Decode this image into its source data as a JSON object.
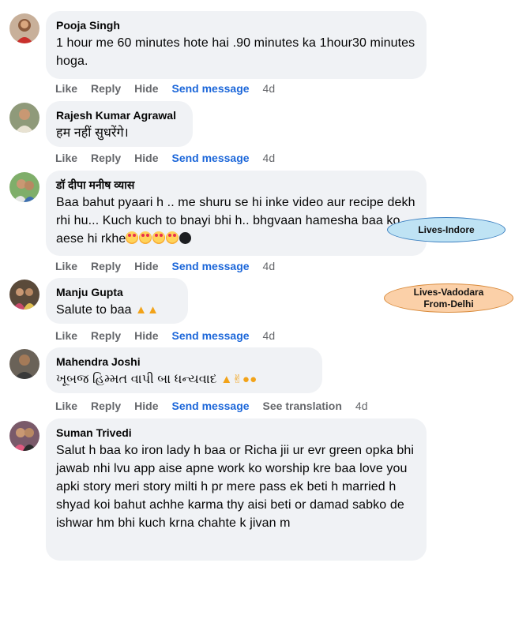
{
  "comments": [
    {
      "author": "Pooja Singh",
      "text": "1 hour me 60 minutes hote hai .90 minutes ka 1hour30 minutes hoga.",
      "actions": {
        "like": "Like",
        "reply": "Reply",
        "hide": "Hide",
        "send": "Send message",
        "time": "4d"
      }
    },
    {
      "author": "Rajesh Kumar Agrawal",
      "text": "हम नहीं सुधरेंगे।",
      "actions": {
        "like": "Like",
        "reply": "Reply",
        "hide": "Hide",
        "send": "Send message",
        "time": "4d"
      }
    },
    {
      "author": "डॉ दीपा मनीष व्यास",
      "text": "Baa bahut pyaari h .. me shuru se hi inke video aur recipe dekh rhi hu... Kuch kuch to bnayi bhi h.. bhgvaan hamesha baa ko aese hi rkhe",
      "actions": {
        "like": "Like",
        "reply": "Reply",
        "hide": "Hide",
        "send": "Send message",
        "time": "4d"
      }
    },
    {
      "author": "Manju Gupta",
      "text": "Salute to baa",
      "actions": {
        "like": "Like",
        "reply": "Reply",
        "hide": "Hide",
        "send": "Send message",
        "time": "4d"
      }
    },
    {
      "author": "Mahendra Joshi",
      "text": "ખૂબજ હિમ્મત વાપી બા ધન્યવાદ",
      "actions": {
        "like": "Like",
        "reply": "Reply",
        "hide": "Hide",
        "send": "Send message",
        "translate": "See translation",
        "time": "4d"
      }
    },
    {
      "author": "Suman Trivedi",
      "text": "Salut h baa ko iron lady h baa or Richa jii ur evr green opka bhi jawab nhi lvu app aise apne work ko worship kre baa love you apki story meri story milti h pr mere pass ek beti h married h shyad koi bahut achhe karma thy aisi beti or damad sabko de ishwar hm bhi kuch krna chahte k jivan m"
    }
  ],
  "annotations": {
    "indore": "Lives-Indore",
    "vadodara_line1": "Lives-Vadodara",
    "vadodara_line2": "From-Delhi"
  },
  "colors": {
    "bubble": "#f0f2f5",
    "link": "#1b66d9",
    "meta": "#65676b"
  }
}
